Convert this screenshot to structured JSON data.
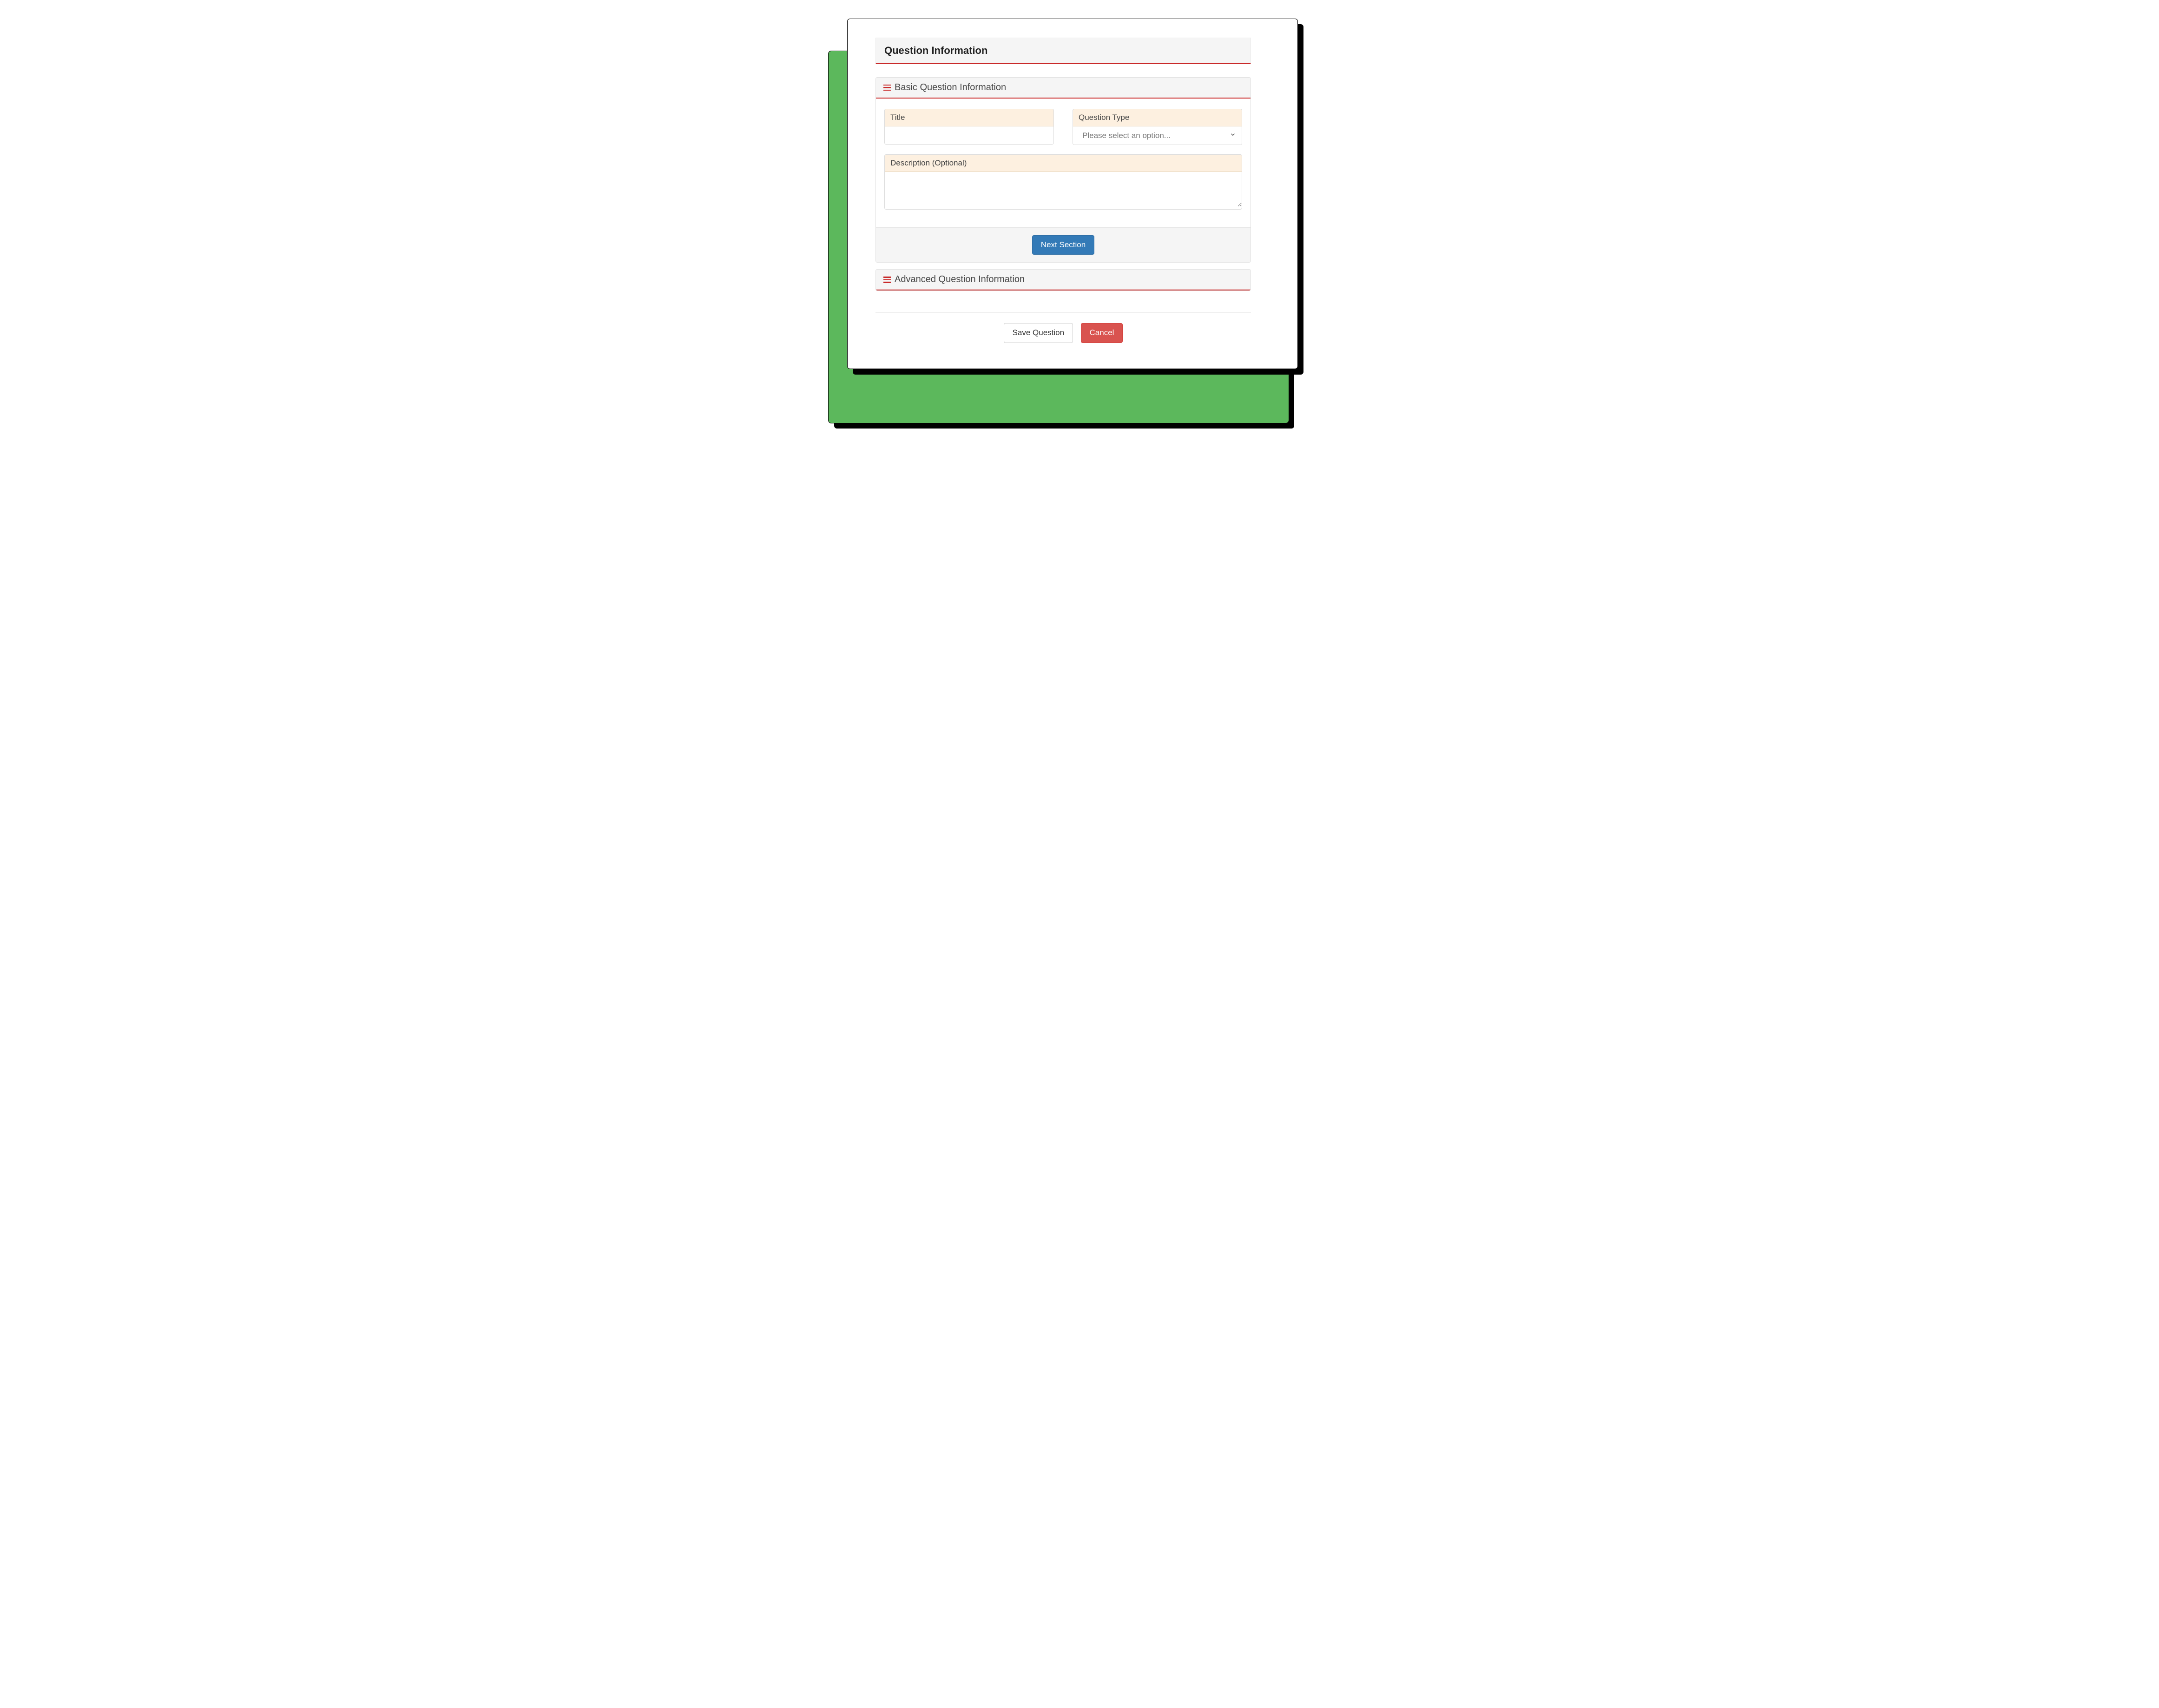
{
  "colors": {
    "accent_red": "#c92a2a",
    "primary_blue": "#337ab7",
    "danger": "#d9534f",
    "backdrop_green": "#5cb85c",
    "label_bg": "#fdf0e0"
  },
  "page": {
    "header_title": "Question Information"
  },
  "sections": {
    "basic": {
      "title": "Basic Question Information",
      "fields": {
        "title": {
          "label": "Title",
          "value": ""
        },
        "question_type": {
          "label": "Question Type",
          "placeholder": "Please select an option...",
          "value": ""
        },
        "description": {
          "label": "Description (Optional)",
          "value": ""
        }
      },
      "next_button": "Next Section"
    },
    "advanced": {
      "title": "Advanced Question Information"
    }
  },
  "footer": {
    "save_label": "Save Question",
    "cancel_label": "Cancel"
  }
}
